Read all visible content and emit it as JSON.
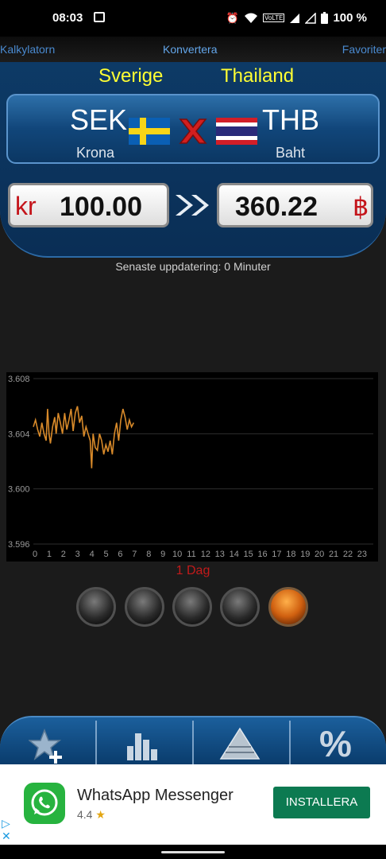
{
  "status_bar": {
    "time": "08:03",
    "battery": "100 %",
    "volte": "VoLTE"
  },
  "nav": {
    "left": "Kalkylatorn",
    "center": "Konvertera",
    "right": "Favoriter"
  },
  "converter": {
    "from_country": "Sverige",
    "to_country": "Thailand",
    "from_code": "SEK",
    "to_code": "THB",
    "from_name": "Krona",
    "to_name": "Baht",
    "from_symbol": "kr",
    "to_symbol": "฿",
    "from_amount": "100.00",
    "to_amount": "360.22"
  },
  "update_text": "Senaste uppdatering: 0 Minuter",
  "chart_data": {
    "type": "line",
    "y_ticks": [
      "3.608",
      "3.604",
      "3.600",
      "3.596"
    ],
    "ylim": [
      3.596,
      3.608
    ],
    "x_ticks": [
      "0",
      "1",
      "2",
      "3",
      "4",
      "5",
      "6",
      "7",
      "8",
      "9",
      "10",
      "11",
      "12",
      "13",
      "14",
      "15",
      "16",
      "17",
      "18",
      "19",
      "20",
      "21",
      "22",
      "23"
    ],
    "xlim": [
      0,
      23.9
    ],
    "period_label": "1 Dag",
    "line_color": "#d88a2a",
    "series": [
      {
        "x": [
          0.0,
          0.15,
          0.3,
          0.45,
          0.6,
          0.75,
          0.9,
          1.0,
          1.1,
          1.2,
          1.35,
          1.5,
          1.6,
          1.75,
          1.9,
          2.05,
          2.2,
          2.35,
          2.5,
          2.65,
          2.8,
          2.95,
          3.1,
          3.25,
          3.4,
          3.55,
          3.7,
          3.85,
          4.0,
          4.1,
          4.2,
          4.35,
          4.5,
          4.65,
          4.8,
          4.95,
          5.1,
          5.25,
          5.4,
          5.55,
          5.7,
          5.85,
          6.0,
          6.15,
          6.3,
          6.45,
          6.6,
          6.75,
          6.9,
          7.05
        ],
        "values": [
          3.6045,
          3.605,
          3.6043,
          3.6038,
          3.6048,
          3.604,
          3.6035,
          3.6058,
          3.604,
          3.6033,
          3.6045,
          3.6052,
          3.604,
          3.6055,
          3.6048,
          3.604,
          3.6055,
          3.6043,
          3.605,
          3.6058,
          3.6042,
          3.6055,
          3.606,
          3.6048,
          3.6053,
          3.6038,
          3.6045,
          3.604,
          3.6035,
          3.6015,
          3.604,
          3.603,
          3.6028,
          3.604,
          3.6035,
          3.6025,
          3.6032,
          3.6027,
          3.6035,
          3.6025,
          3.604,
          3.6048,
          3.6035,
          3.605,
          3.6058,
          3.6052,
          3.6043,
          3.605,
          3.6045,
          3.6048
        ]
      }
    ]
  },
  "range_buttons": [
    {
      "active": false
    },
    {
      "active": false
    },
    {
      "active": false
    },
    {
      "active": false
    },
    {
      "active": true
    }
  ],
  "bottom_tabs": {
    "add_favorite": "star-plus-icon",
    "chart": "bar-chart-icon",
    "pyramid": "pyramid-icon",
    "percent": "%"
  },
  "ad": {
    "title": "WhatsApp Messenger",
    "rating": "4.4",
    "cta": "INSTALLERA",
    "choices": "▷\n✕"
  },
  "colors": {
    "accent_blue": "#0d3a66",
    "yellow": "#ffff33",
    "red_symbol": "#c4141a",
    "cta_green": "#0c7a51"
  }
}
